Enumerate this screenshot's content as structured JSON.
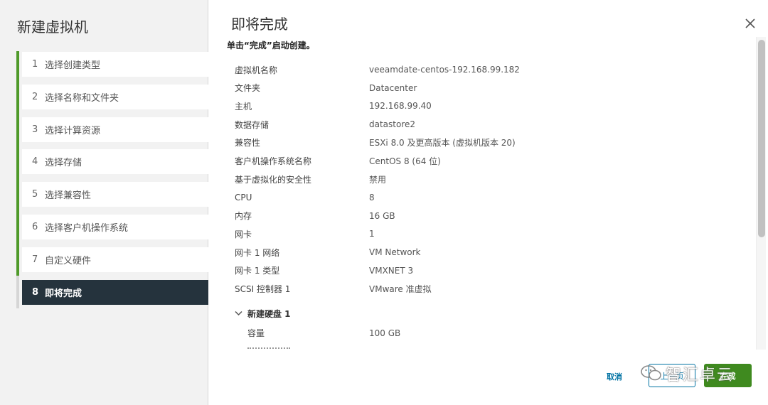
{
  "wizard": {
    "title": "新建虚拟机",
    "steps": [
      {
        "num": "1",
        "label": "选择创建类型"
      },
      {
        "num": "2",
        "label": "选择名称和文件夹"
      },
      {
        "num": "3",
        "label": "选择计算资源"
      },
      {
        "num": "4",
        "label": "选择存储"
      },
      {
        "num": "5",
        "label": "选择兼容性"
      },
      {
        "num": "6",
        "label": "选择客户机操作系统"
      },
      {
        "num": "7",
        "label": "自定义硬件"
      },
      {
        "num": "8",
        "label": "即将完成"
      }
    ],
    "active_step": "8"
  },
  "page": {
    "title": "即将完成",
    "subtitle": "单击“完成”启动创建。",
    "summary": [
      {
        "key": "虚拟机名称",
        "value": "veeamdate-centos-192.168.99.182"
      },
      {
        "key": "文件夹",
        "value": "Datacenter"
      },
      {
        "key": "主机",
        "value": "192.168.99.40"
      },
      {
        "key": "数据存储",
        "value": "datastore2"
      },
      {
        "key": "兼容性",
        "value": "ESXi 8.0 及更高版本 (虚拟机版本 20)"
      },
      {
        "key": "客户机操作系统名称",
        "value": "CentOS 8 (64 位)"
      },
      {
        "key": "基于虚拟化的安全性",
        "value": "禁用"
      },
      {
        "key": "CPU",
        "value": "8"
      },
      {
        "key": "内存",
        "value": "16 GB"
      },
      {
        "key": "网卡",
        "value": "1"
      },
      {
        "key": "网卡 1 网络",
        "value": "VM Network"
      },
      {
        "key": "网卡 1 类型",
        "value": "VMXNET 3"
      },
      {
        "key": "SCSI 控制器 1",
        "value": "VMware 准虚拟"
      }
    ],
    "disk_section": {
      "label": "新建硬盘 1",
      "rows": [
        {
          "key": "容量",
          "value": "100 GB"
        }
      ]
    }
  },
  "footer": {
    "cancel_label": "取消",
    "back_label": "上一页",
    "finish_label": "完成"
  },
  "watermark": {
    "text": "智汇卓云"
  },
  "colors": {
    "accent": "#0072a3",
    "finish": "#3f8a1f",
    "active_step_bg": "#25333d",
    "progress_rail": "#4f9a2a"
  }
}
